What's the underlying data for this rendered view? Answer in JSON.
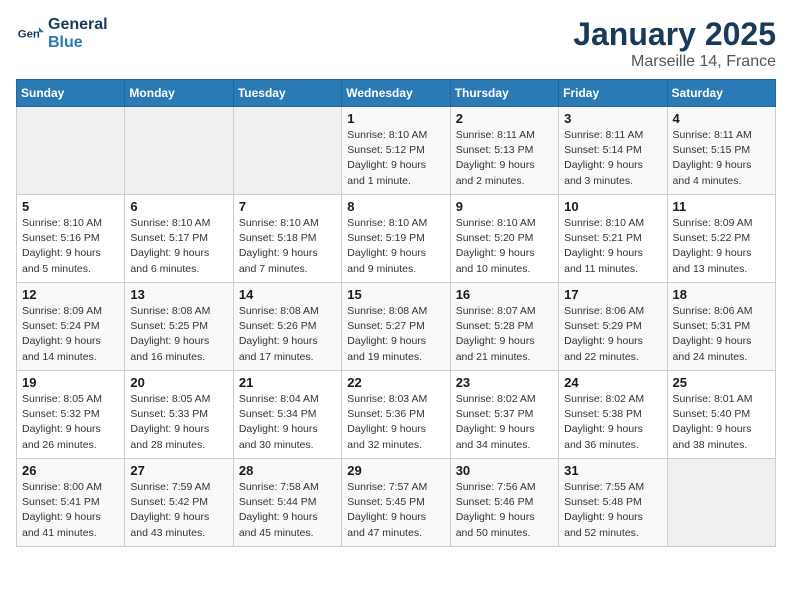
{
  "header": {
    "logo_line1": "General",
    "logo_line2": "Blue",
    "title": "January 2025",
    "subtitle": "Marseille 14, France"
  },
  "weekdays": [
    "Sunday",
    "Monday",
    "Tuesday",
    "Wednesday",
    "Thursday",
    "Friday",
    "Saturday"
  ],
  "weeks": [
    [
      {
        "day": "",
        "info": ""
      },
      {
        "day": "",
        "info": ""
      },
      {
        "day": "",
        "info": ""
      },
      {
        "day": "1",
        "info": "Sunrise: 8:10 AM\nSunset: 5:12 PM\nDaylight: 9 hours\nand 1 minute."
      },
      {
        "day": "2",
        "info": "Sunrise: 8:11 AM\nSunset: 5:13 PM\nDaylight: 9 hours\nand 2 minutes."
      },
      {
        "day": "3",
        "info": "Sunrise: 8:11 AM\nSunset: 5:14 PM\nDaylight: 9 hours\nand 3 minutes."
      },
      {
        "day": "4",
        "info": "Sunrise: 8:11 AM\nSunset: 5:15 PM\nDaylight: 9 hours\nand 4 minutes."
      }
    ],
    [
      {
        "day": "5",
        "info": "Sunrise: 8:10 AM\nSunset: 5:16 PM\nDaylight: 9 hours\nand 5 minutes."
      },
      {
        "day": "6",
        "info": "Sunrise: 8:10 AM\nSunset: 5:17 PM\nDaylight: 9 hours\nand 6 minutes."
      },
      {
        "day": "7",
        "info": "Sunrise: 8:10 AM\nSunset: 5:18 PM\nDaylight: 9 hours\nand 7 minutes."
      },
      {
        "day": "8",
        "info": "Sunrise: 8:10 AM\nSunset: 5:19 PM\nDaylight: 9 hours\nand 9 minutes."
      },
      {
        "day": "9",
        "info": "Sunrise: 8:10 AM\nSunset: 5:20 PM\nDaylight: 9 hours\nand 10 minutes."
      },
      {
        "day": "10",
        "info": "Sunrise: 8:10 AM\nSunset: 5:21 PM\nDaylight: 9 hours\nand 11 minutes."
      },
      {
        "day": "11",
        "info": "Sunrise: 8:09 AM\nSunset: 5:22 PM\nDaylight: 9 hours\nand 13 minutes."
      }
    ],
    [
      {
        "day": "12",
        "info": "Sunrise: 8:09 AM\nSunset: 5:24 PM\nDaylight: 9 hours\nand 14 minutes."
      },
      {
        "day": "13",
        "info": "Sunrise: 8:08 AM\nSunset: 5:25 PM\nDaylight: 9 hours\nand 16 minutes."
      },
      {
        "day": "14",
        "info": "Sunrise: 8:08 AM\nSunset: 5:26 PM\nDaylight: 9 hours\nand 17 minutes."
      },
      {
        "day": "15",
        "info": "Sunrise: 8:08 AM\nSunset: 5:27 PM\nDaylight: 9 hours\nand 19 minutes."
      },
      {
        "day": "16",
        "info": "Sunrise: 8:07 AM\nSunset: 5:28 PM\nDaylight: 9 hours\nand 21 minutes."
      },
      {
        "day": "17",
        "info": "Sunrise: 8:06 AM\nSunset: 5:29 PM\nDaylight: 9 hours\nand 22 minutes."
      },
      {
        "day": "18",
        "info": "Sunrise: 8:06 AM\nSunset: 5:31 PM\nDaylight: 9 hours\nand 24 minutes."
      }
    ],
    [
      {
        "day": "19",
        "info": "Sunrise: 8:05 AM\nSunset: 5:32 PM\nDaylight: 9 hours\nand 26 minutes."
      },
      {
        "day": "20",
        "info": "Sunrise: 8:05 AM\nSunset: 5:33 PM\nDaylight: 9 hours\nand 28 minutes."
      },
      {
        "day": "21",
        "info": "Sunrise: 8:04 AM\nSunset: 5:34 PM\nDaylight: 9 hours\nand 30 minutes."
      },
      {
        "day": "22",
        "info": "Sunrise: 8:03 AM\nSunset: 5:36 PM\nDaylight: 9 hours\nand 32 minutes."
      },
      {
        "day": "23",
        "info": "Sunrise: 8:02 AM\nSunset: 5:37 PM\nDaylight: 9 hours\nand 34 minutes."
      },
      {
        "day": "24",
        "info": "Sunrise: 8:02 AM\nSunset: 5:38 PM\nDaylight: 9 hours\nand 36 minutes."
      },
      {
        "day": "25",
        "info": "Sunrise: 8:01 AM\nSunset: 5:40 PM\nDaylight: 9 hours\nand 38 minutes."
      }
    ],
    [
      {
        "day": "26",
        "info": "Sunrise: 8:00 AM\nSunset: 5:41 PM\nDaylight: 9 hours\nand 41 minutes."
      },
      {
        "day": "27",
        "info": "Sunrise: 7:59 AM\nSunset: 5:42 PM\nDaylight: 9 hours\nand 43 minutes."
      },
      {
        "day": "28",
        "info": "Sunrise: 7:58 AM\nSunset: 5:44 PM\nDaylight: 9 hours\nand 45 minutes."
      },
      {
        "day": "29",
        "info": "Sunrise: 7:57 AM\nSunset: 5:45 PM\nDaylight: 9 hours\nand 47 minutes."
      },
      {
        "day": "30",
        "info": "Sunrise: 7:56 AM\nSunset: 5:46 PM\nDaylight: 9 hours\nand 50 minutes."
      },
      {
        "day": "31",
        "info": "Sunrise: 7:55 AM\nSunset: 5:48 PM\nDaylight: 9 hours\nand 52 minutes."
      },
      {
        "day": "",
        "info": ""
      }
    ]
  ]
}
